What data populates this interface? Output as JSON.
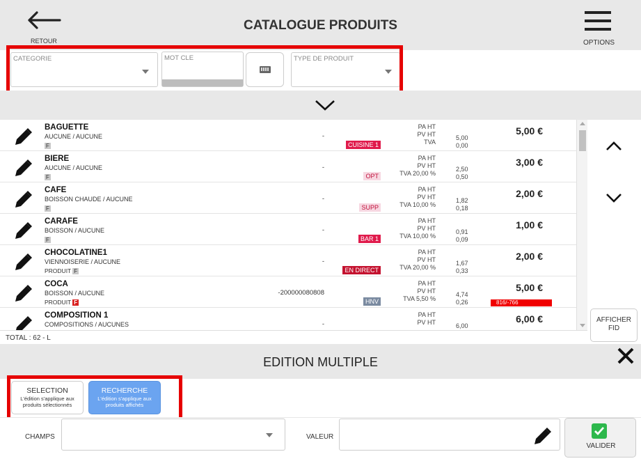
{
  "header": {
    "back_label": "RETOUR",
    "title": "CATALOGUE PRODUITS",
    "options_label": "OPTIONS"
  },
  "filters": {
    "categorie_label": "CATEGORIE",
    "mot_cle_label": "MOT CLE",
    "type_produit_label": "TYPE DE PRODUIT",
    "keyboard_icon": "keyboard-icon"
  },
  "colors": {
    "highlight": "#e60000",
    "accent_blue": "#6ba4f0",
    "stock_red": "#f00000",
    "valider_green": "#2db84c"
  },
  "products": [
    {
      "name": "BAGUETTE",
      "category": "AUCUNE / AUCUNE",
      "type_text": "",
      "badge": "F",
      "badge_style": "grey",
      "code": "-",
      "tag": "CUISINE 1",
      "tag_bg": "#e01b4c",
      "tag_fg": "#ffffff",
      "labels": [
        "PA HT",
        "PV HT",
        "TVA"
      ],
      "values": [
        "5,00",
        "0,00"
      ],
      "price": "5,00 €",
      "stock": ""
    },
    {
      "name": "BIERE",
      "category": "AUCUNE / AUCUNE",
      "type_text": "",
      "badge": "F",
      "badge_style": "grey",
      "code": "-",
      "tag": "OPT",
      "tag_bg": "#f7d7e1",
      "tag_fg": "#c0123c",
      "labels": [
        "PA HT",
        "PV HT",
        "TVA 20,00 %"
      ],
      "values": [
        "2,50",
        "0,50"
      ],
      "price": "3,00 €",
      "stock": ""
    },
    {
      "name": "CAFE",
      "category": "BOISSON CHAUDE / AUCUNE",
      "type_text": "",
      "badge": "F",
      "badge_style": "grey",
      "code": "-",
      "tag": "SUPP",
      "tag_bg": "#f7d7e1",
      "tag_fg": "#c0123c",
      "labels": [
        "PA HT",
        "PV HT",
        "TVA 10,00 %"
      ],
      "values": [
        "1,82",
        "0,18"
      ],
      "price": "2,00 €",
      "stock": ""
    },
    {
      "name": "CARAFE",
      "category": "BOISSON / AUCUNE",
      "type_text": "",
      "badge": "F",
      "badge_style": "grey",
      "code": "-",
      "tag": "BAR 1",
      "tag_bg": "#e01b4c",
      "tag_fg": "#ffffff",
      "labels": [
        "PA HT",
        "PV HT",
        "TVA 10,00 %"
      ],
      "values": [
        "0,91",
        "0,09"
      ],
      "price": "1,00 €",
      "stock": ""
    },
    {
      "name": "CHOCOLATINE1",
      "category": "VIENNOISERIE / AUCUNE",
      "type_text": "PRODUIT",
      "badge": "F",
      "badge_style": "grey",
      "code": "-",
      "tag": "EN DIRECT",
      "tag_bg": "#c4122f",
      "tag_fg": "#ffffff",
      "labels": [
        "PA HT",
        "PV HT",
        "TVA 20,00 %"
      ],
      "values": [
        "1,67",
        "0,33"
      ],
      "price": "2,00 €",
      "stock": ""
    },
    {
      "name": "COCA",
      "category": "BOISSON / AUCUNE",
      "type_text": "PRODUIT",
      "badge": "F",
      "badge_style": "red",
      "code": "-200000080808",
      "tag": "HNV",
      "tag_bg": "#7a8aa0",
      "tag_fg": "#ffffff",
      "labels": [
        "PA HT",
        "PV HT",
        "TVA 5,50 %"
      ],
      "values": [
        "4,74",
        "0,26"
      ],
      "price": "5,00 €",
      "stock": "816/-766"
    },
    {
      "name": "COMPOSITION 1",
      "category": "COMPOSITIONS / AUCUNES",
      "type_text": "",
      "badge": "",
      "badge_style": "grey",
      "code": "-",
      "tag": "",
      "tag_bg": "#ffffff",
      "tag_fg": "#000000",
      "labels": [
        "PA HT",
        "PV HT",
        ""
      ],
      "values": [
        "6,00",
        ""
      ],
      "price": "6,00 €",
      "stock": ""
    }
  ],
  "side": {
    "afficher_fid_label_1": "AFFICHER",
    "afficher_fid_label_2": "FID"
  },
  "total": "TOTAL : 62 - L",
  "edition": {
    "title": "EDITION MULTIPLE",
    "selection_title": "SELECTION",
    "selection_desc": "L'édition s'applique aux produits sélectionnés",
    "recherche_title": "RECHERCHE",
    "recherche_desc": "L'édition s'applique aux produits affichés",
    "champs_label": "CHAMPS",
    "valeur_label": "VALEUR",
    "valider_label": "VALIDER"
  }
}
